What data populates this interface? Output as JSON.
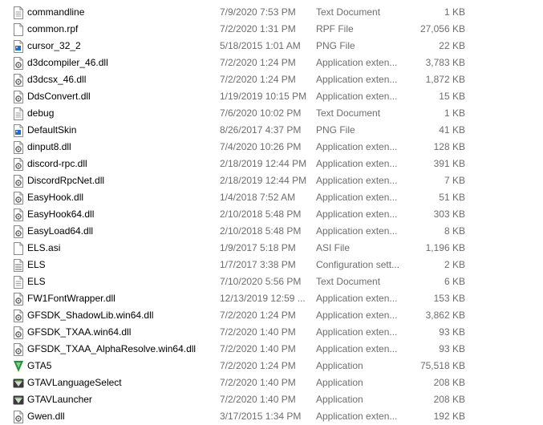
{
  "files": [
    {
      "name": "commandline",
      "date": "7/9/2020 7:53 PM",
      "type": "Text Document",
      "size": "1 KB",
      "icon": "text-file-icon"
    },
    {
      "name": "common.rpf",
      "date": "7/2/2020 1:31 PM",
      "type": "RPF File",
      "size": "27,056 KB",
      "icon": "generic-file-icon"
    },
    {
      "name": "cursor_32_2",
      "date": "5/18/2015 1:01 AM",
      "type": "PNG File",
      "size": "22 KB",
      "icon": "image-file-icon"
    },
    {
      "name": "d3dcompiler_46.dll",
      "date": "7/2/2020 1:24 PM",
      "type": "Application exten...",
      "size": "3,783 KB",
      "icon": "dll-file-icon"
    },
    {
      "name": "d3dcsx_46.dll",
      "date": "7/2/2020 1:24 PM",
      "type": "Application exten...",
      "size": "1,872 KB",
      "icon": "dll-file-icon"
    },
    {
      "name": "DdsConvert.dll",
      "date": "1/19/2019 10:15 PM",
      "type": "Application exten...",
      "size": "15 KB",
      "icon": "dll-file-icon"
    },
    {
      "name": "debug",
      "date": "7/6/2020 10:02 PM",
      "type": "Text Document",
      "size": "1 KB",
      "icon": "text-file-icon"
    },
    {
      "name": "DefaultSkin",
      "date": "8/26/2017 4:37 PM",
      "type": "PNG File",
      "size": "41 KB",
      "icon": "image-file-icon"
    },
    {
      "name": "dinput8.dll",
      "date": "7/4/2020 10:26 PM",
      "type": "Application exten...",
      "size": "128 KB",
      "icon": "dll-file-icon"
    },
    {
      "name": "discord-rpc.dll",
      "date": "2/18/2019 12:44 PM",
      "type": "Application exten...",
      "size": "391 KB",
      "icon": "dll-file-icon"
    },
    {
      "name": "DiscordRpcNet.dll",
      "date": "2/18/2019 12:44 PM",
      "type": "Application exten...",
      "size": "7 KB",
      "icon": "dll-file-icon"
    },
    {
      "name": "EasyHook.dll",
      "date": "1/4/2018 7:52 AM",
      "type": "Application exten...",
      "size": "51 KB",
      "icon": "dll-file-icon"
    },
    {
      "name": "EasyHook64.dll",
      "date": "2/10/2018 5:48 PM",
      "type": "Application exten...",
      "size": "303 KB",
      "icon": "dll-file-icon"
    },
    {
      "name": "EasyLoad64.dll",
      "date": "2/10/2018 5:48 PM",
      "type": "Application exten...",
      "size": "8 KB",
      "icon": "dll-file-icon"
    },
    {
      "name": "ELS.asi",
      "date": "1/9/2017 5:18 PM",
      "type": "ASI File",
      "size": "1,196 KB",
      "icon": "generic-file-icon"
    },
    {
      "name": "ELS",
      "date": "1/7/2017 3:38 PM",
      "type": "Configuration sett...",
      "size": "2 KB",
      "icon": "config-file-icon"
    },
    {
      "name": "ELS",
      "date": "7/10/2020 5:56 PM",
      "type": "Text Document",
      "size": "6 KB",
      "icon": "text-file-icon"
    },
    {
      "name": "FW1FontWrapper.dll",
      "date": "12/13/2019 12:59 ...",
      "type": "Application exten...",
      "size": "153 KB",
      "icon": "dll-file-icon"
    },
    {
      "name": "GFSDK_ShadowLib.win64.dll",
      "date": "7/2/2020 1:24 PM",
      "type": "Application exten...",
      "size": "3,862 KB",
      "icon": "dll-file-icon"
    },
    {
      "name": "GFSDK_TXAA.win64.dll",
      "date": "7/2/2020 1:40 PM",
      "type": "Application exten...",
      "size": "93 KB",
      "icon": "dll-file-icon"
    },
    {
      "name": "GFSDK_TXAA_AlphaResolve.win64.dll",
      "date": "7/2/2020 1:40 PM",
      "type": "Application exten...",
      "size": "93 KB",
      "icon": "dll-file-icon"
    },
    {
      "name": "GTA5",
      "date": "7/2/2020 1:24 PM",
      "type": "Application",
      "size": "75,518 KB",
      "icon": "gta5-app-icon"
    },
    {
      "name": "GTAVLanguageSelect",
      "date": "7/2/2020 1:40 PM",
      "type": "Application",
      "size": "208 KB",
      "icon": "gtav-app-icon"
    },
    {
      "name": "GTAVLauncher",
      "date": "7/2/2020 1:40 PM",
      "type": "Application",
      "size": "208 KB",
      "icon": "gtav-app-icon"
    },
    {
      "name": "Gwen.dll",
      "date": "3/17/2015 1:34 PM",
      "type": "Application exten...",
      "size": "192 KB",
      "icon": "dll-file-icon"
    }
  ],
  "colors": {
    "name_text": "#000000",
    "meta_text": "#6d6d6d",
    "icon_outline": "#8a8a8a",
    "image_icon_accent": "#1e6fc7",
    "gta_icon_green": "#2e8b3a"
  }
}
